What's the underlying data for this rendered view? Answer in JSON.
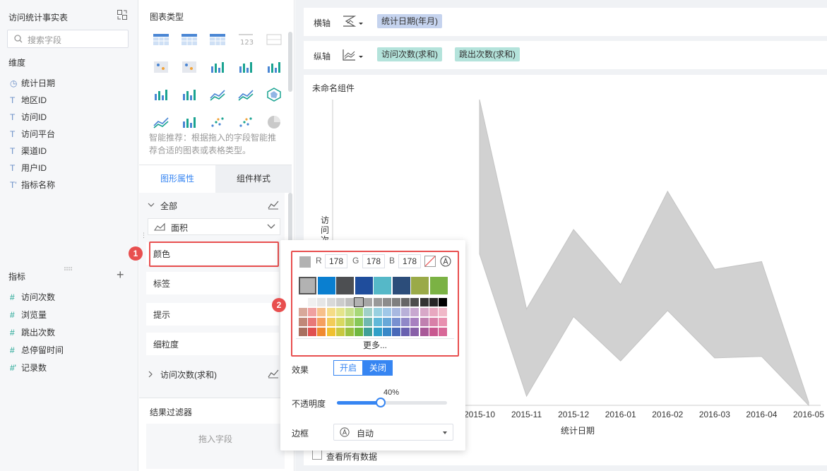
{
  "left": {
    "dataset_title": "访问统计事实表",
    "search_placeholder": "搜索字段",
    "dimension_header": "维度",
    "dimensions": [
      {
        "label": "统计日期",
        "icon": "clock-icon"
      },
      {
        "label": "地区ID",
        "icon": "text-icon"
      },
      {
        "label": "访问ID",
        "icon": "text-icon"
      },
      {
        "label": "访问平台",
        "icon": "text-icon"
      },
      {
        "label": "渠道ID",
        "icon": "text-icon"
      },
      {
        "label": "用户ID",
        "icon": "text-icon"
      },
      {
        "label": "指标名称",
        "icon": "text-calc-icon"
      }
    ],
    "measure_header": "指标",
    "measures": [
      "访问次数",
      "浏览量",
      "跳出次数",
      "总停留时间",
      "记录数"
    ]
  },
  "middle": {
    "chart_type_header": "图表类型",
    "smart_note": "智能推荐：根据拖入的字段智能推荐合适的图表或表格类型。",
    "tab_graph": "图形属性",
    "tab_style": "组件样式",
    "all_label": "全部",
    "type_select": "面积",
    "props": [
      "颜色",
      "标签",
      "提示",
      "细粒度"
    ],
    "series_group": "访问次数(求和)",
    "filter_header": "结果过滤器",
    "filter_drop": "拖入字段"
  },
  "right": {
    "x_axis_label": "横轴",
    "y_axis_label": "纵轴",
    "x_field": "统计日期(年月)",
    "y_fields": [
      "访问次数(求和)",
      "跳出次数(求和)"
    ],
    "component_title": "未命名组件",
    "view_all": "查看所有数据"
  },
  "popup": {
    "r_label": "R",
    "g_label": "G",
    "b_label": "B",
    "r": "178",
    "g": "178",
    "b": "178",
    "more": "更多...",
    "effect_label": "效果",
    "effect_on": "开启",
    "effect_off": "关闭",
    "opacity_label": "不透明度",
    "opacity_value": "40%",
    "opacity": 0.4,
    "border_label": "边框",
    "border_value": "自动"
  },
  "badges": [
    "1",
    "2"
  ],
  "colors": {
    "accent": "#3685f2",
    "area_fill": "#b2b2b2",
    "highlight": "#e84f4f"
  },
  "chart_data": {
    "type": "area",
    "x": [
      "2015-10",
      "2015-11",
      "2015-12",
      "2016-01",
      "2016-02",
      "2016-03",
      "2016-04",
      "2016-05"
    ],
    "series": [
      {
        "name": "访问次数(求和)",
        "values": [
          1000,
          315,
          575,
          395,
          700,
          445,
          470,
          10
        ]
      },
      {
        "name": "跳出次数(求和)",
        "values": [
          495,
          30,
          290,
          145,
          310,
          155,
          160,
          0
        ]
      }
    ],
    "xlabel": "统计日期",
    "ylabel": "访问次",
    "ylim": [
      0,
      1000
    ],
    "grid": false
  }
}
